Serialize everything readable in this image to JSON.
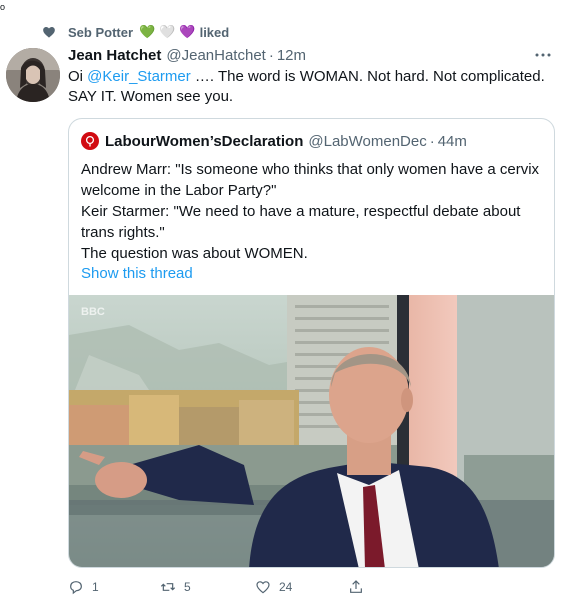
{
  "social_context": {
    "liker_name": "Seb Potter",
    "emojis": [
      "💚",
      "🤍",
      "💜"
    ],
    "suffix": "liked"
  },
  "corner_mark": "o",
  "tweet": {
    "display_name": "Jean Hatchet",
    "handle": "@JeanHatchet",
    "separator": "·",
    "time": "12m",
    "text_prefix": "Oi ",
    "mention": "@Keir_Starmer",
    "text_rest": " …. The word is WOMAN. Not hard. Not complicated. SAY IT. Women see you."
  },
  "quoted_tweet": {
    "display_name": "LabourWomen’sDeclaration",
    "handle": "@LabWomenDec",
    "separator": "·",
    "time": "44m",
    "lines": [
      "Andrew Marr: \"Is someone who thinks that only women have a cervix welcome in the Labor Party?\"",
      "Keir Starmer: \"We need to have a mature, respectful debate about trans rights.\"",
      "The question was about WOMEN."
    ],
    "show_thread": "Show this thread",
    "media_watermark": "BBC"
  },
  "actions": {
    "reply_count": "1",
    "retweet_count": "5",
    "like_count": "24"
  },
  "colors": {
    "accent": "#1d9bf0",
    "secondary_text": "#536471",
    "labour_red": "#d10a11"
  },
  "icons": [
    "heart-icon",
    "more-icon",
    "reply-icon",
    "retweet-icon",
    "like-icon",
    "share-icon",
    "labour-rose-icon"
  ]
}
